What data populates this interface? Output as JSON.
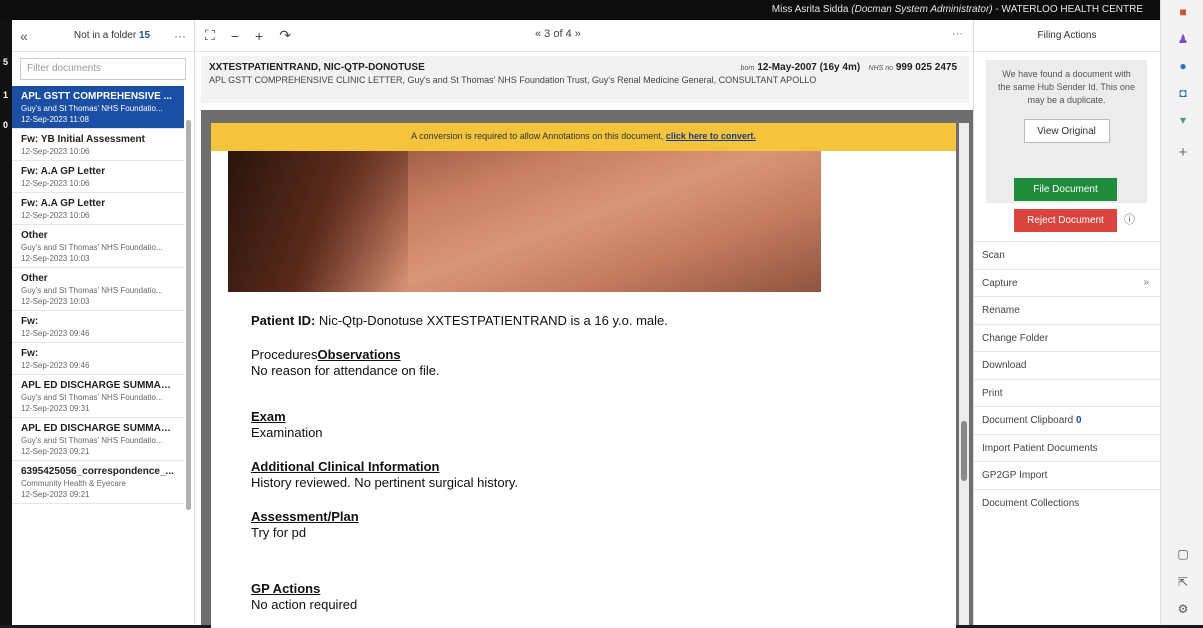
{
  "topbar": {
    "user_name": "Miss Asrita Sidda",
    "user_role": "(Docman System Administrator)",
    "practice": "- WATERLOO HEALTH CENTRE"
  },
  "left_edge": [
    "5",
    "1",
    "0"
  ],
  "doc_list": {
    "back_icon": "double-chevron-left-icon",
    "title": "Not in a folder",
    "count": "15",
    "menu": "···",
    "filter_placeholder": "Filter documents",
    "items": [
      {
        "title": "APL GSTT COMPREHENSIVE ...",
        "sub": "Guy's and St Thomas' NHS Foundatio...",
        "date": "12-Sep-2023 11:08",
        "selected": true
      },
      {
        "title": "Fw: YB Initial Assessment",
        "sub": "",
        "date": "12-Sep-2023 10:06"
      },
      {
        "title": "Fw: A.A GP Letter",
        "sub": "",
        "date": "12-Sep-2023 10:06"
      },
      {
        "title": "Fw: A.A GP Letter",
        "sub": "",
        "date": "12-Sep-2023 10:06"
      },
      {
        "title": "Other",
        "sub": "Guy's and St Thomas' NHS Foundatio...",
        "date": "12-Sep-2023 10:03"
      },
      {
        "title": "Other",
        "sub": "Guy's and St Thomas' NHS Foundatio...",
        "date": "12-Sep-2023 10:03"
      },
      {
        "title": "Fw:",
        "sub": "",
        "date": "12-Sep-2023 09:46"
      },
      {
        "title": "Fw:",
        "sub": "",
        "date": "12-Sep-2023 09:46"
      },
      {
        "title": "APL ED DISCHARGE SUMMAR...",
        "sub": "Guy's and St Thomas' NHS Foundatio...",
        "date": "12-Sep-2023 09:31"
      },
      {
        "title": "APL ED DISCHARGE SUMMAR...",
        "sub": "Guy's and St Thomas' NHS Foundatio...",
        "date": "12-Sep-2023 09:21"
      },
      {
        "title": "6395425056_correspondence_...",
        "sub": "Community Health & Eyecare",
        "date": "12-Sep-2023 09:21"
      }
    ]
  },
  "viewer_toolbar": {
    "pager": "« 3 of 4 »",
    "menu": "···"
  },
  "patient": {
    "name": "XXTESTPATIENTRAND, NIC-QTP-DONOTUSE",
    "description": "APL GSTT COMPREHENSIVE CLINIC LETTER, Guy's and St Thomas' NHS Foundation Trust, Guy's Renal Medicine General, CONSULTANT APOLLO",
    "born_label": "born",
    "dob": "12-May-2007 (16y 4m)",
    "nhs_label": "NHS no",
    "nhs_no": "999 025 2475"
  },
  "document": {
    "banner_text": "A conversion is required to allow Annotations on this document,",
    "banner_link": "click here to convert.",
    "patient_id_label": "Patient ID:",
    "patient_id_text": "Nic-Qtp-Donotuse XXTESTPATIENTRAND is a 16 y.o. male.",
    "procedures_label": "Procedures",
    "observations_label": "Observations",
    "observations_text": "No reason for attendance on file.",
    "exam_label": "Exam",
    "exam_text": "Examination",
    "aci_label": "Additional Clinical Information",
    "aci_text": "History reviewed. No pertinent surgical history.",
    "plan_label": "Assessment/Plan",
    "plan_text": "Try for pd",
    "gp_label": "GP Actions",
    "gp_text": "No action required"
  },
  "filing": {
    "title": "Filing Actions",
    "duplicate_msg": "We have found a document with the same Hub Sender Id. This one may be a duplicate.",
    "view_original": "View Original",
    "file_document": "File Document",
    "reject_document": "Reject Document",
    "actions": [
      {
        "label": "Scan"
      },
      {
        "label": "Capture",
        "chevron": "»"
      },
      {
        "label": "Rename"
      },
      {
        "label": "Change Folder"
      },
      {
        "label": "Download"
      },
      {
        "label": "Print"
      },
      {
        "label": "Document Clipboard",
        "count": "0"
      },
      {
        "label": "Import Patient Documents"
      },
      {
        "label": "GP2GP Import"
      },
      {
        "label": "Document Collections"
      }
    ]
  },
  "colors": {
    "selected_item": "#1b4ea5",
    "file_button": "#1e8c3a",
    "reject_button": "#d9453e",
    "banner": "#f4c43c"
  }
}
